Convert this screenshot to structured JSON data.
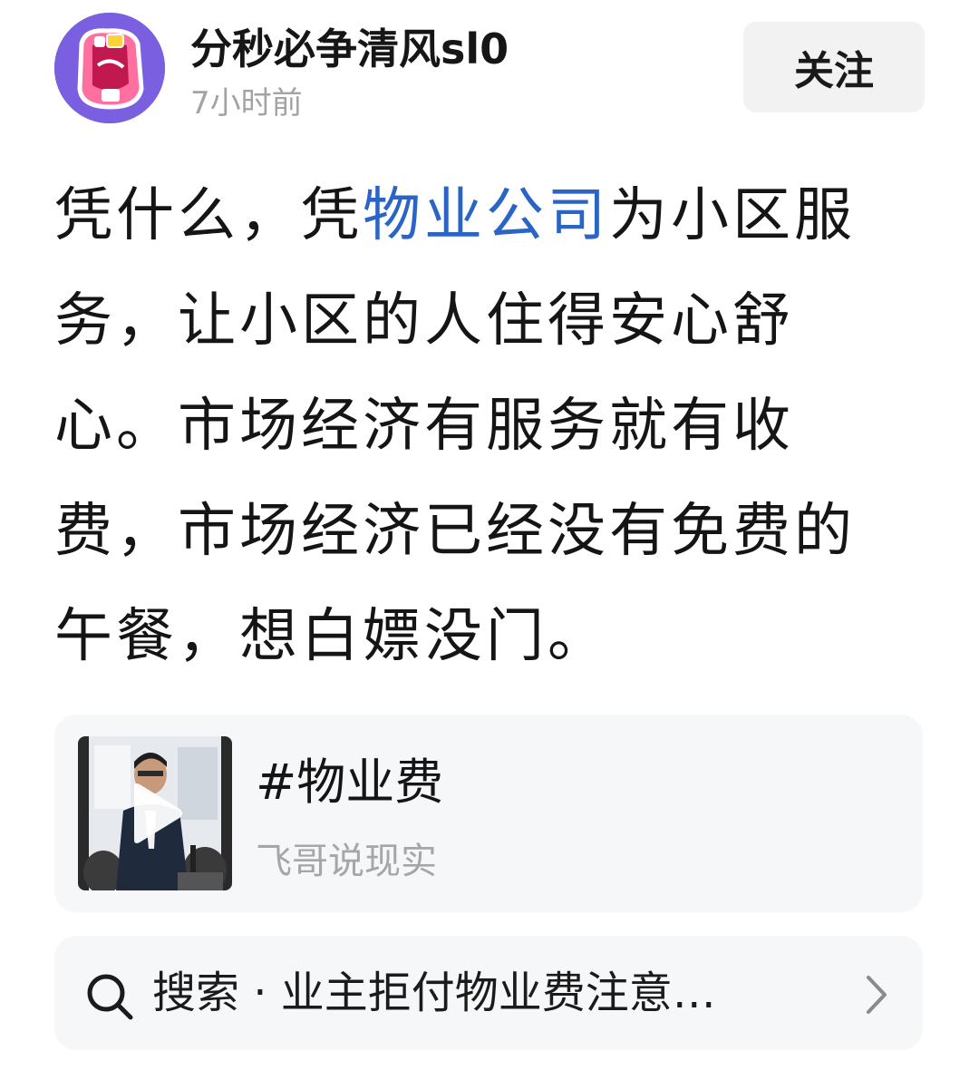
{
  "author": {
    "name": "分秒必争清风sl0",
    "time": "7小时前",
    "avatar_icon": "screaming-mouth-avatar",
    "follow_label": "关注"
  },
  "post": {
    "text_before": "凭什么，凭",
    "link_text": "物业公司",
    "text_after": "为小区服务，让小区的人住得安心舒心。市场经济有服务就有收费，市场经济已经没有免费的午餐，想白嫖没门。",
    "link_color": "#2a64c6"
  },
  "topic_card": {
    "title": "#物业费",
    "author": "飞哥说现实",
    "thumb_icon": "play-icon"
  },
  "search": {
    "icon": "search-icon",
    "text": "搜索 · 业主拒付物业费注意…",
    "chevron": "chevron-right-icon"
  },
  "colors": {
    "avatar_bg": "#7a5fe0",
    "card_bg": "#f6f7f9",
    "button_bg": "#f2f2f2",
    "muted_text": "#a3a3a3"
  }
}
